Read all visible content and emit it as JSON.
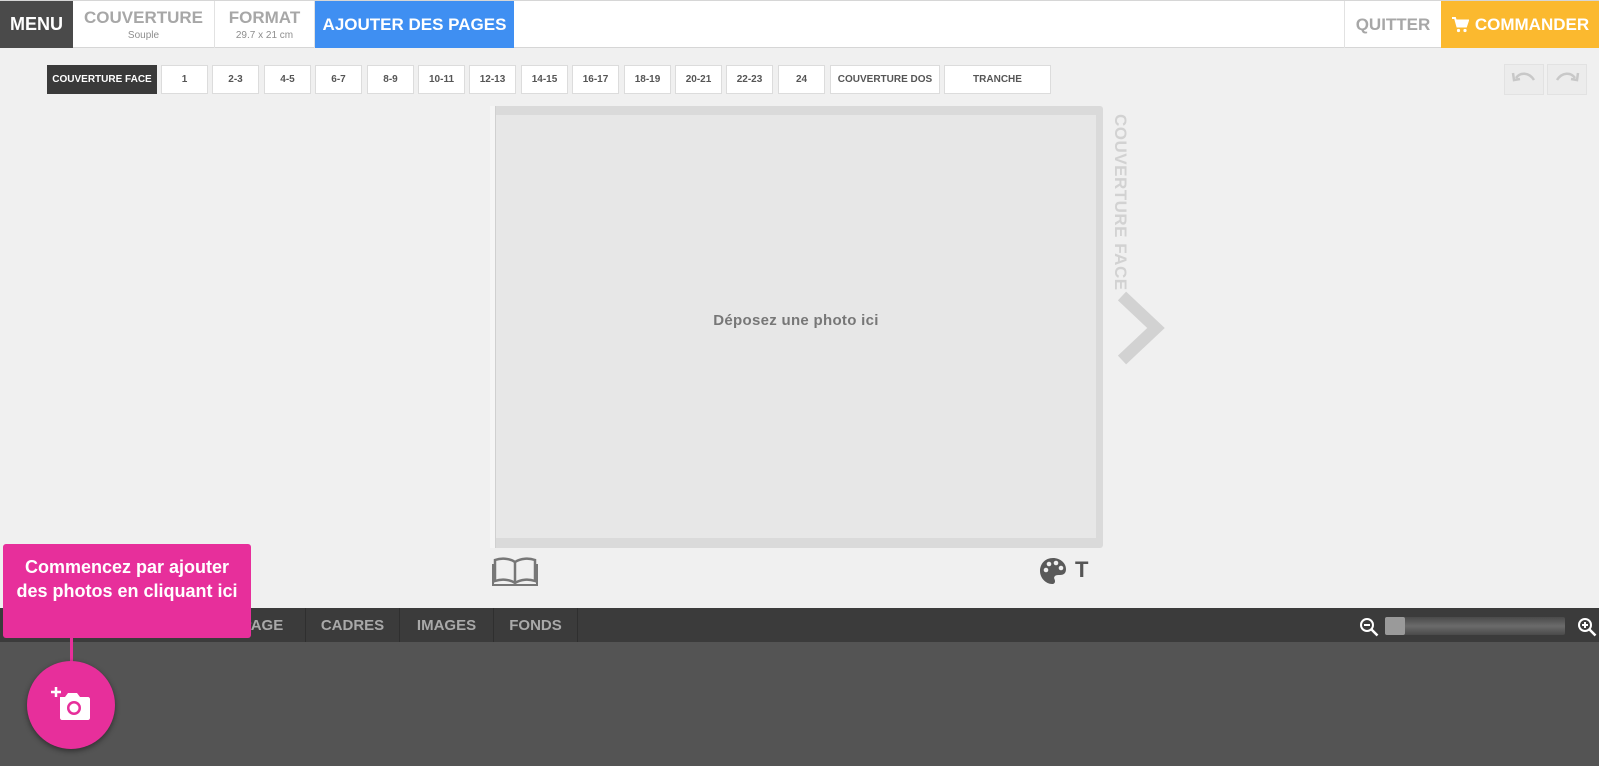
{
  "topbar": {
    "menu": "MENU",
    "couverture": "COUVERTURE",
    "couverture_sub": "Souple",
    "format": "FORMAT",
    "format_sub": "29.7 x 21 cm",
    "ajouter": "AJOUTER DES PAGES",
    "quitter": "QUITTER",
    "commander": "COMMANDER"
  },
  "page_tabs": [
    "COUVERTURE FACE",
    "1",
    "2-3",
    "4-5",
    "6-7",
    "8-9",
    "10-11",
    "12-13",
    "14-15",
    "16-17",
    "18-19",
    "20-21",
    "22-23",
    "24",
    "COUVERTURE DOS",
    "TRANCHE"
  ],
  "active_page_tab": "COUVERTURE FACE",
  "canvas": {
    "drop_text": "Déposez une photo ici",
    "side_label": "COUVERTURE FACE"
  },
  "tools": {
    "text_icon_glyph": "T"
  },
  "bottom_tabs": [
    "PAGE",
    "CADRES",
    "IMAGES",
    "FONDS"
  ],
  "zoom": {
    "level": 0.1
  },
  "tooltip": "Commencez par ajouter des photos en cliquant ici",
  "colors": {
    "menu_bg": "#4a4a4a",
    "accent_blue": "#3f8ff2",
    "accent_orange": "#fbb92f",
    "accent_pink": "#e72f9b",
    "panel_dark": "#3b3b3b"
  }
}
